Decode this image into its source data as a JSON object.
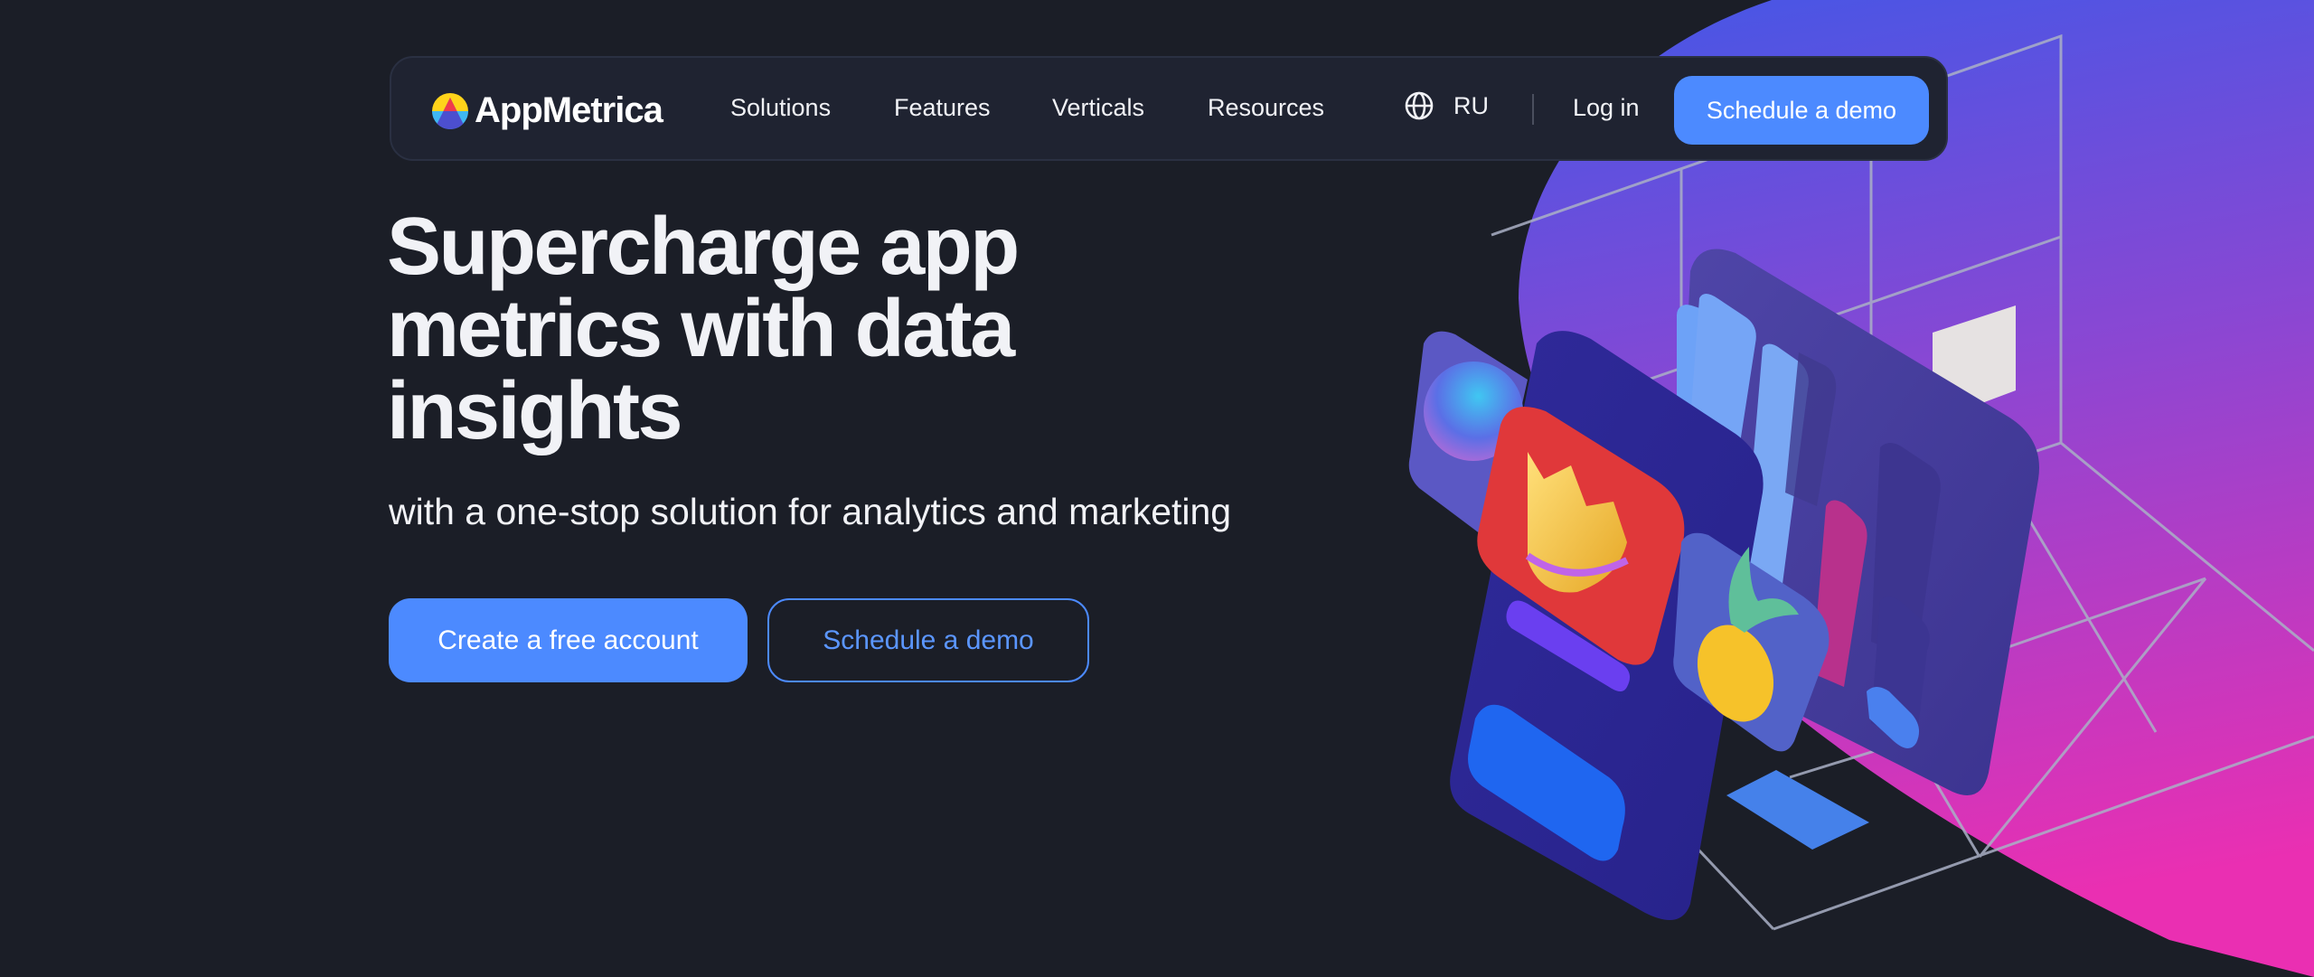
{
  "brand": {
    "name": "AppMetrica",
    "logo_icon": "appmetrica-logo-icon",
    "accent_color": "#4c8aff"
  },
  "nav": {
    "items": [
      {
        "label": "Solutions"
      },
      {
        "label": "Features"
      },
      {
        "label": "Verticals"
      },
      {
        "label": "Resources"
      }
    ],
    "language": {
      "icon": "globe-icon",
      "label": "RU"
    },
    "login_label": "Log in",
    "cta_label": "Schedule a demo"
  },
  "hero": {
    "headline": "Supercharge app metrics with data insights",
    "subheadline": "with a one-stop solution for analytics and marketing",
    "primary_cta": "Create a free account",
    "secondary_cta": "Schedule a demo",
    "illustration": "3d-phone-dashboard-illustration"
  },
  "colors": {
    "background": "#1b1e27",
    "header_bg": "#1f2331",
    "gradient_top": "#4457e6",
    "gradient_bottom": "#e331b5"
  }
}
